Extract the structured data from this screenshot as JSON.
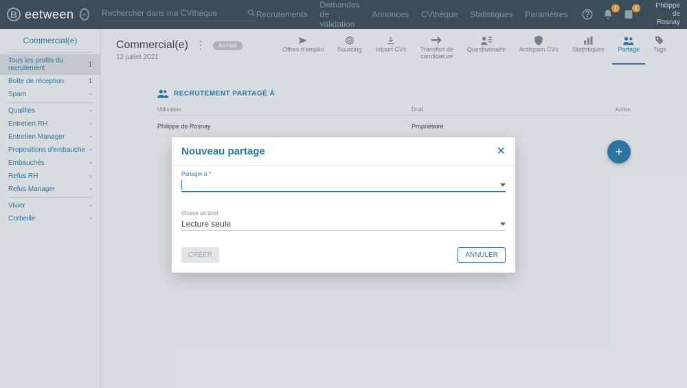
{
  "header": {
    "logo": "eetween",
    "search_placeholder": "Rechercher dans ma CVthèque",
    "nav": [
      "Recrutements",
      "Demandes de validation",
      "Annonces",
      "CVthèque",
      "Statistiques",
      "Paramètres"
    ],
    "notif_badge": "1",
    "task_badge": "1",
    "user_line1": "Philippe",
    "user_line2": "de Rosnay"
  },
  "sidebar": {
    "title": "Commercial(e)",
    "groups": [
      [
        {
          "label": "Tous les profils du recrutement",
          "count": "1",
          "active": true
        },
        {
          "label": "Boîte de réception",
          "count": "1"
        },
        {
          "label": "Spam",
          "count": "-"
        }
      ],
      [
        {
          "label": "Qualifiés",
          "count": "-"
        },
        {
          "label": "Entretien RH",
          "count": "-"
        },
        {
          "label": "Entretien Manager",
          "count": "-"
        },
        {
          "label": "Propositions d'embauche",
          "count": "-"
        },
        {
          "label": "Embauchés",
          "count": "-"
        },
        {
          "label": "Refus RH",
          "count": "-"
        },
        {
          "label": "Refus Manager",
          "count": "-"
        }
      ],
      [
        {
          "label": "Vivier",
          "count": "-"
        },
        {
          "label": "Corbeille",
          "count": "-"
        }
      ]
    ]
  },
  "page": {
    "title": "Commercial(e)",
    "archive_label": "Archivé",
    "date": "12 juillet 2021"
  },
  "tabs": [
    {
      "label": "Offres d'emploi",
      "icon": "send"
    },
    {
      "label": "Sourcing",
      "icon": "target"
    },
    {
      "label": "Import CVs",
      "icon": "download"
    },
    {
      "label": "Transfert de\ncandidature",
      "icon": "transfer"
    },
    {
      "label": "Questionnaire",
      "icon": "questionnaire"
    },
    {
      "label": "Antispam CVs",
      "icon": "shield"
    },
    {
      "label": "Statistiques",
      "icon": "stats"
    },
    {
      "label": "Partage",
      "icon": "share",
      "active": true
    },
    {
      "label": "Tags",
      "icon": "tag"
    }
  ],
  "share": {
    "heading": "RECRUTEMENT PARTAGÉ À",
    "columns": {
      "user": "Utilisateur",
      "right": "Droit",
      "action": "Action"
    },
    "rows": [
      {
        "user": "Philippe de Rosnay",
        "right": "Propriétaire"
      }
    ]
  },
  "modal": {
    "title": "Nouveau partage",
    "field_share_label": "Partager à *",
    "field_right_label": "Choisir un droit",
    "field_right_value": "Lecture seule",
    "create_label": "CRÉER",
    "cancel_label": "ANNULER"
  }
}
